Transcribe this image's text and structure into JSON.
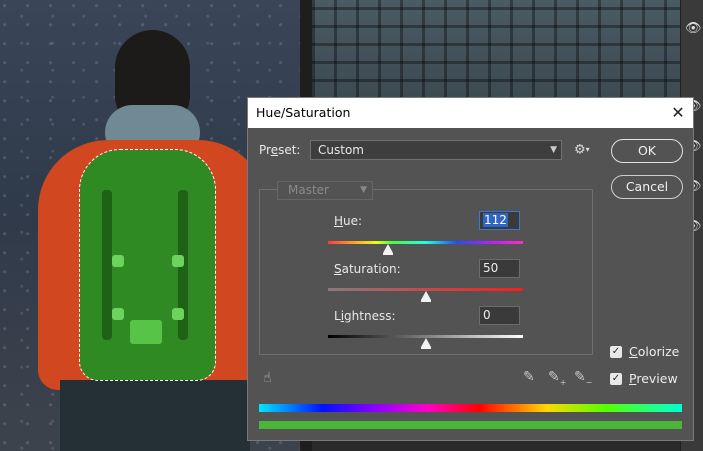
{
  "dialog": {
    "title": "Hue/Saturation",
    "close_glyph": "✕",
    "preset": {
      "label_pre": "Pr",
      "label_u": "e",
      "label_post": "set:",
      "value": "Custom"
    },
    "ok_label": "OK",
    "cancel_label": "Cancel",
    "channel": "Master",
    "hue": {
      "label_u": "H",
      "label_rest": "ue:",
      "value": "112",
      "fraction": 0.31
    },
    "saturation": {
      "label_u": "S",
      "label_rest": "aturation:",
      "value": "50",
      "fraction": 0.5
    },
    "lightness": {
      "label_pre": "L",
      "label_u": "i",
      "label_rest": "ghtness:",
      "value": "0",
      "fraction": 0.5
    },
    "colorize": {
      "label_u": "C",
      "label_rest": "olorize",
      "checked": true
    },
    "preview": {
      "label_u": "P",
      "label_rest": "review",
      "checked": true
    }
  },
  "icons": {
    "gear": "gear-icon",
    "hand": "hand-tool-icon",
    "eyedropper": "eyedropper-icon",
    "eyedropper_plus": "eyedropper-plus-icon",
    "eyedropper_minus": "eyedropper-minus-icon",
    "eye": "eye-icon"
  },
  "colors": {
    "dialog_bg": "#535353",
    "selection_highlight": "#2f66c4",
    "result_swatch": "#4bb538"
  }
}
